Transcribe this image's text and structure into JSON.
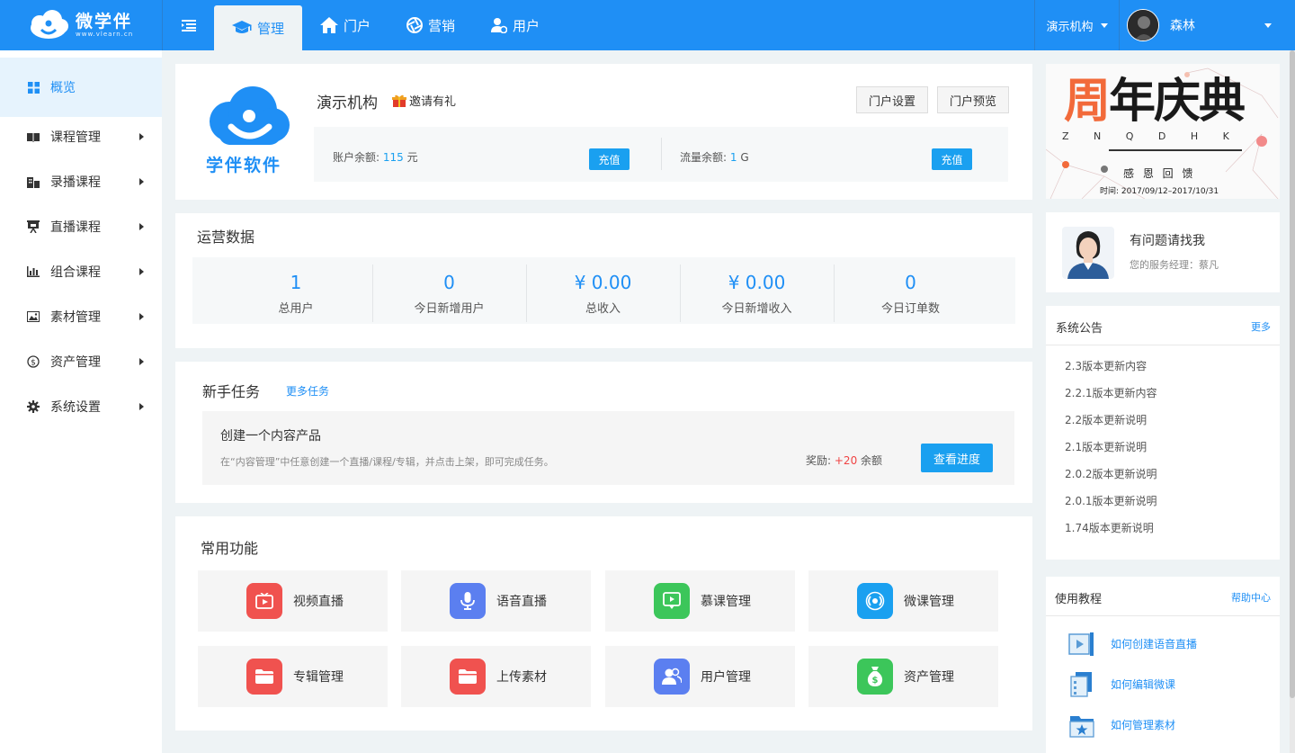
{
  "header": {
    "logo_text": "微学伴",
    "logo_subtext": "www.vlearn.cn",
    "nav": [
      {
        "label": "管理",
        "icon": "graduation-cap-icon",
        "active": true
      },
      {
        "label": "门户",
        "icon": "home-icon"
      },
      {
        "label": "营销",
        "icon": "aperture-icon"
      },
      {
        "label": "用户",
        "icon": "user-settings-icon"
      }
    ],
    "org_select": "演示机构",
    "user_name": "森林"
  },
  "sidebar": {
    "items": [
      {
        "label": "概览",
        "icon": "grid-icon",
        "active": true
      },
      {
        "label": "课程管理",
        "icon": "book-icon"
      },
      {
        "label": "录播课程",
        "icon": "building-icon"
      },
      {
        "label": "直播课程",
        "icon": "presentation-icon"
      },
      {
        "label": "组合课程",
        "icon": "bar-chart-icon"
      },
      {
        "label": "素材管理",
        "icon": "image-icon"
      },
      {
        "label": "资产管理",
        "icon": "dollar-icon"
      },
      {
        "label": "系统设置",
        "icon": "gear-icon"
      }
    ]
  },
  "org_card": {
    "logo_text": "学伴软件",
    "name": "演示机构",
    "invite": "邀请有礼",
    "portal_settings": "门户设置",
    "portal_preview": "门户预览",
    "account_label": "账户余额:",
    "account_value": "115",
    "account_unit": "元",
    "traffic_label": "流量余额:",
    "traffic_value": "1",
    "traffic_unit": "G",
    "recharge": "充值"
  },
  "ops": {
    "title": "运营数据",
    "stats": [
      {
        "value": "1",
        "label": "总用户"
      },
      {
        "value": "0",
        "label": "今日新增用户"
      },
      {
        "value": "¥ 0.00",
        "label": "总收入"
      },
      {
        "value": "¥ 0.00",
        "label": "今日新增收入"
      },
      {
        "value": "0",
        "label": "今日订单数"
      }
    ]
  },
  "tasks": {
    "title": "新手任务",
    "more": "更多任务",
    "task_title": "创建一个内容产品",
    "task_desc": "在“内容管理”中任意创建一个直播/课程/专辑，并点击上架，即可完成任务。",
    "reward_label": "奖励:",
    "reward_value": "+20",
    "reward_unit": "余额",
    "progress_button": "查看进度"
  },
  "functions": {
    "title": "常用功能",
    "items": [
      {
        "label": "视频直播",
        "icon": "video-live-icon",
        "color": "#f0524f"
      },
      {
        "label": "语音直播",
        "icon": "microphone-icon",
        "color": "#5b7ff0"
      },
      {
        "label": "慕课管理",
        "icon": "mooc-icon",
        "color": "#3cc65a"
      },
      {
        "label": "微课管理",
        "icon": "broadcast-icon",
        "color": "#1aa0f0"
      },
      {
        "label": "专辑管理",
        "icon": "folder-icon",
        "color": "#f0524f"
      },
      {
        "label": "上传素材",
        "icon": "folder-icon",
        "color": "#f0524f"
      },
      {
        "label": "用户管理",
        "icon": "users-icon",
        "color": "#5b7ff0"
      },
      {
        "label": "资产管理",
        "icon": "money-bag-icon",
        "color": "#3cc65a"
      }
    ]
  },
  "banner": {
    "title_first": "周",
    "title_rest": "年庆典",
    "letters": "Z N Q D H K",
    "subtitle": "感 恩 回 馈",
    "date": "时间: 2017/09/12–2017/10/31"
  },
  "contact": {
    "title": "有问题请找我",
    "manager": "您的服务经理：蔡凡"
  },
  "notices": {
    "title": "系统公告",
    "more": "更多",
    "items": [
      "2.3版本更新内容",
      "2.2.1版本更新内容",
      "2.2版本更新说明",
      "2.1版本更新说明",
      "2.0.2版本更新说明",
      "2.0.1版本更新说明",
      "1.74版本更新说明"
    ]
  },
  "tutorials": {
    "title": "使用教程",
    "help": "帮助中心",
    "items": [
      {
        "label": "如何创建语音直播",
        "icon": "video-play-icon"
      },
      {
        "label": "如何编辑微课",
        "icon": "document-icon"
      },
      {
        "label": "如何管理素材",
        "icon": "folder-star-icon"
      }
    ]
  },
  "colors": {
    "primary": "#1f8ff5",
    "accent": "#1aa0f0",
    "reward": "#f04444"
  }
}
